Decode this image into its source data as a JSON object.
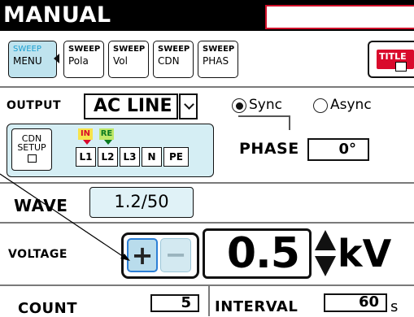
{
  "window": {
    "title": "MANUAL"
  },
  "tabs": [
    {
      "line1": "SWEEP",
      "line2": "MENU"
    },
    {
      "line1": "SWEEP",
      "line2": "Pola"
    },
    {
      "line1": "SWEEP",
      "line2": "Vol"
    },
    {
      "line1": "SWEEP",
      "line2": "CDN"
    },
    {
      "line1": "SWEEP",
      "line2": "PHAS"
    }
  ],
  "title_button": {
    "label": "TITLE"
  },
  "output": {
    "label": "OUTPUT",
    "value": "AC LINE",
    "sync_label": "Sync",
    "async_label": "Async",
    "selected": "Sync"
  },
  "cdn": {
    "setup_line1": "CDN",
    "setup_line2": "SETUP",
    "in_tag": "IN",
    "re_tag": "RE",
    "lines": [
      "L1",
      "L2",
      "L3",
      "N",
      "PE"
    ]
  },
  "phase": {
    "label": "PHASE",
    "value": "0°"
  },
  "wave": {
    "label": "WAVE",
    "value": "1.2/50"
  },
  "voltage": {
    "label": "VOLTAGE",
    "polarity_plus": "+",
    "polarity_minus": "−",
    "value": "0.5",
    "unit": "kV"
  },
  "count": {
    "label": "COUNT",
    "value": "5"
  },
  "interval": {
    "label": "INTERVAL",
    "value": "60",
    "unit": "s"
  },
  "colors": {
    "titlebar": "#000000",
    "accent_red": "#d90a2c",
    "panel_blue": "#d5eef4",
    "button_blue": "#b9dcec",
    "selected_border": "#2d7fd6"
  }
}
